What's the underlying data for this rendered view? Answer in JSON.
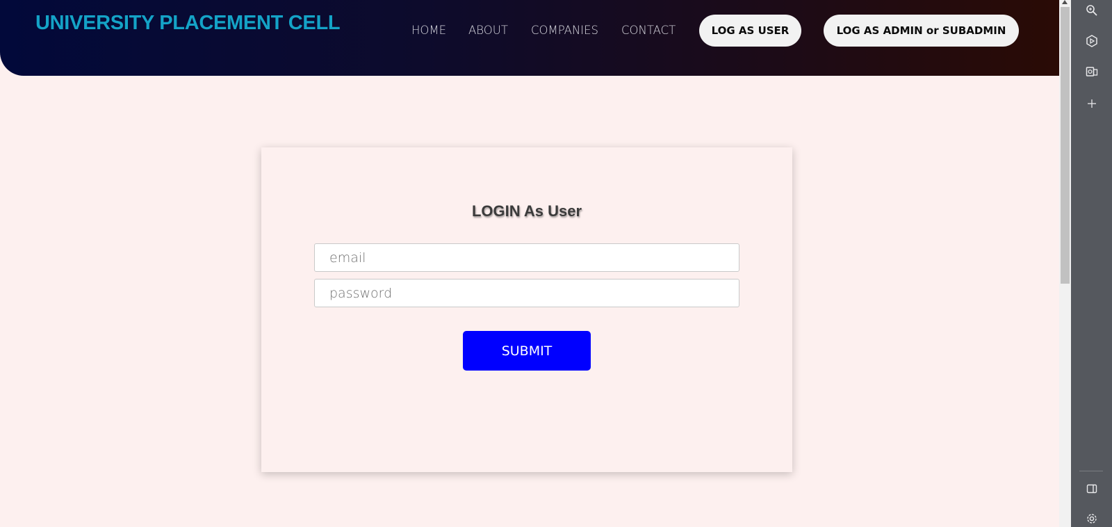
{
  "header": {
    "brand": "UNIVERSITY PLACEMENT CELL",
    "nav": [
      "HOME",
      "ABOUT",
      "COMPANIES",
      "CONTACT"
    ],
    "log_user": "LOG AS USER",
    "log_admin": "LOG AS ADMIN or SUBADMIN"
  },
  "login": {
    "title": "LOGIN As User",
    "email_placeholder": "email",
    "password_placeholder": "password",
    "submit": "SUBMIT"
  },
  "colors": {
    "brand": "#14a3c7",
    "submit": "#0000ff",
    "page_bg": "#fdf0ef"
  },
  "siderail": {
    "icons": [
      "search-icon",
      "copilot-icon",
      "outlook-icon",
      "add-icon",
      "split-panel-icon",
      "settings-icon"
    ]
  }
}
